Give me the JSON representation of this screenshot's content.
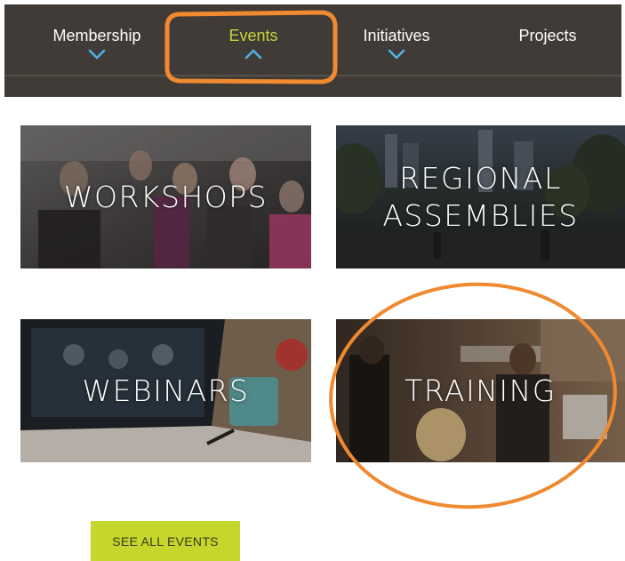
{
  "nav": {
    "items": [
      {
        "label": "Membership",
        "chevron": "down",
        "active": false
      },
      {
        "label": "Events",
        "chevron": "up",
        "active": true
      },
      {
        "label": "Initiatives",
        "chevron": "down",
        "active": false
      },
      {
        "label": "Projects",
        "chevron": "none",
        "active": false
      }
    ],
    "colors": {
      "background": "#403b36",
      "active_text": "#c4d63a",
      "chevron": "#4eb3e6"
    }
  },
  "tiles": [
    {
      "label": "WORKSHOPS"
    },
    {
      "label": "REGIONAL\nASSEMBLIES"
    },
    {
      "label": "WEBINARS"
    },
    {
      "label": "TRAINING"
    }
  ],
  "see_all_button": {
    "label": "SEE ALL EVENTS",
    "color": "#c6d62d"
  },
  "annotations": {
    "color": "#f08a30",
    "circled": [
      "Events",
      "TRAINING"
    ]
  }
}
